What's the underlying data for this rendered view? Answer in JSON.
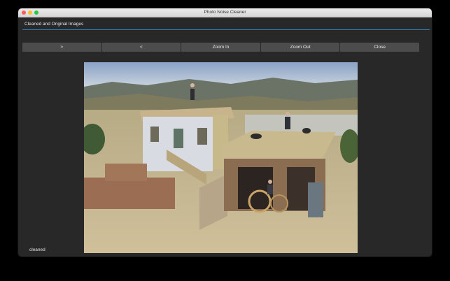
{
  "window": {
    "title": "Photo Noise Cleaner"
  },
  "panel": {
    "title": "Cleaned and Original Images",
    "accent_color": "#2d7fb8"
  },
  "toolbar": {
    "buttons": [
      {
        "label": ">"
      },
      {
        "label": "<"
      },
      {
        "label": "Zoom In"
      },
      {
        "label": "Zoom Out"
      },
      {
        "label": "Close"
      }
    ]
  },
  "image": {
    "label": "cleaned"
  }
}
